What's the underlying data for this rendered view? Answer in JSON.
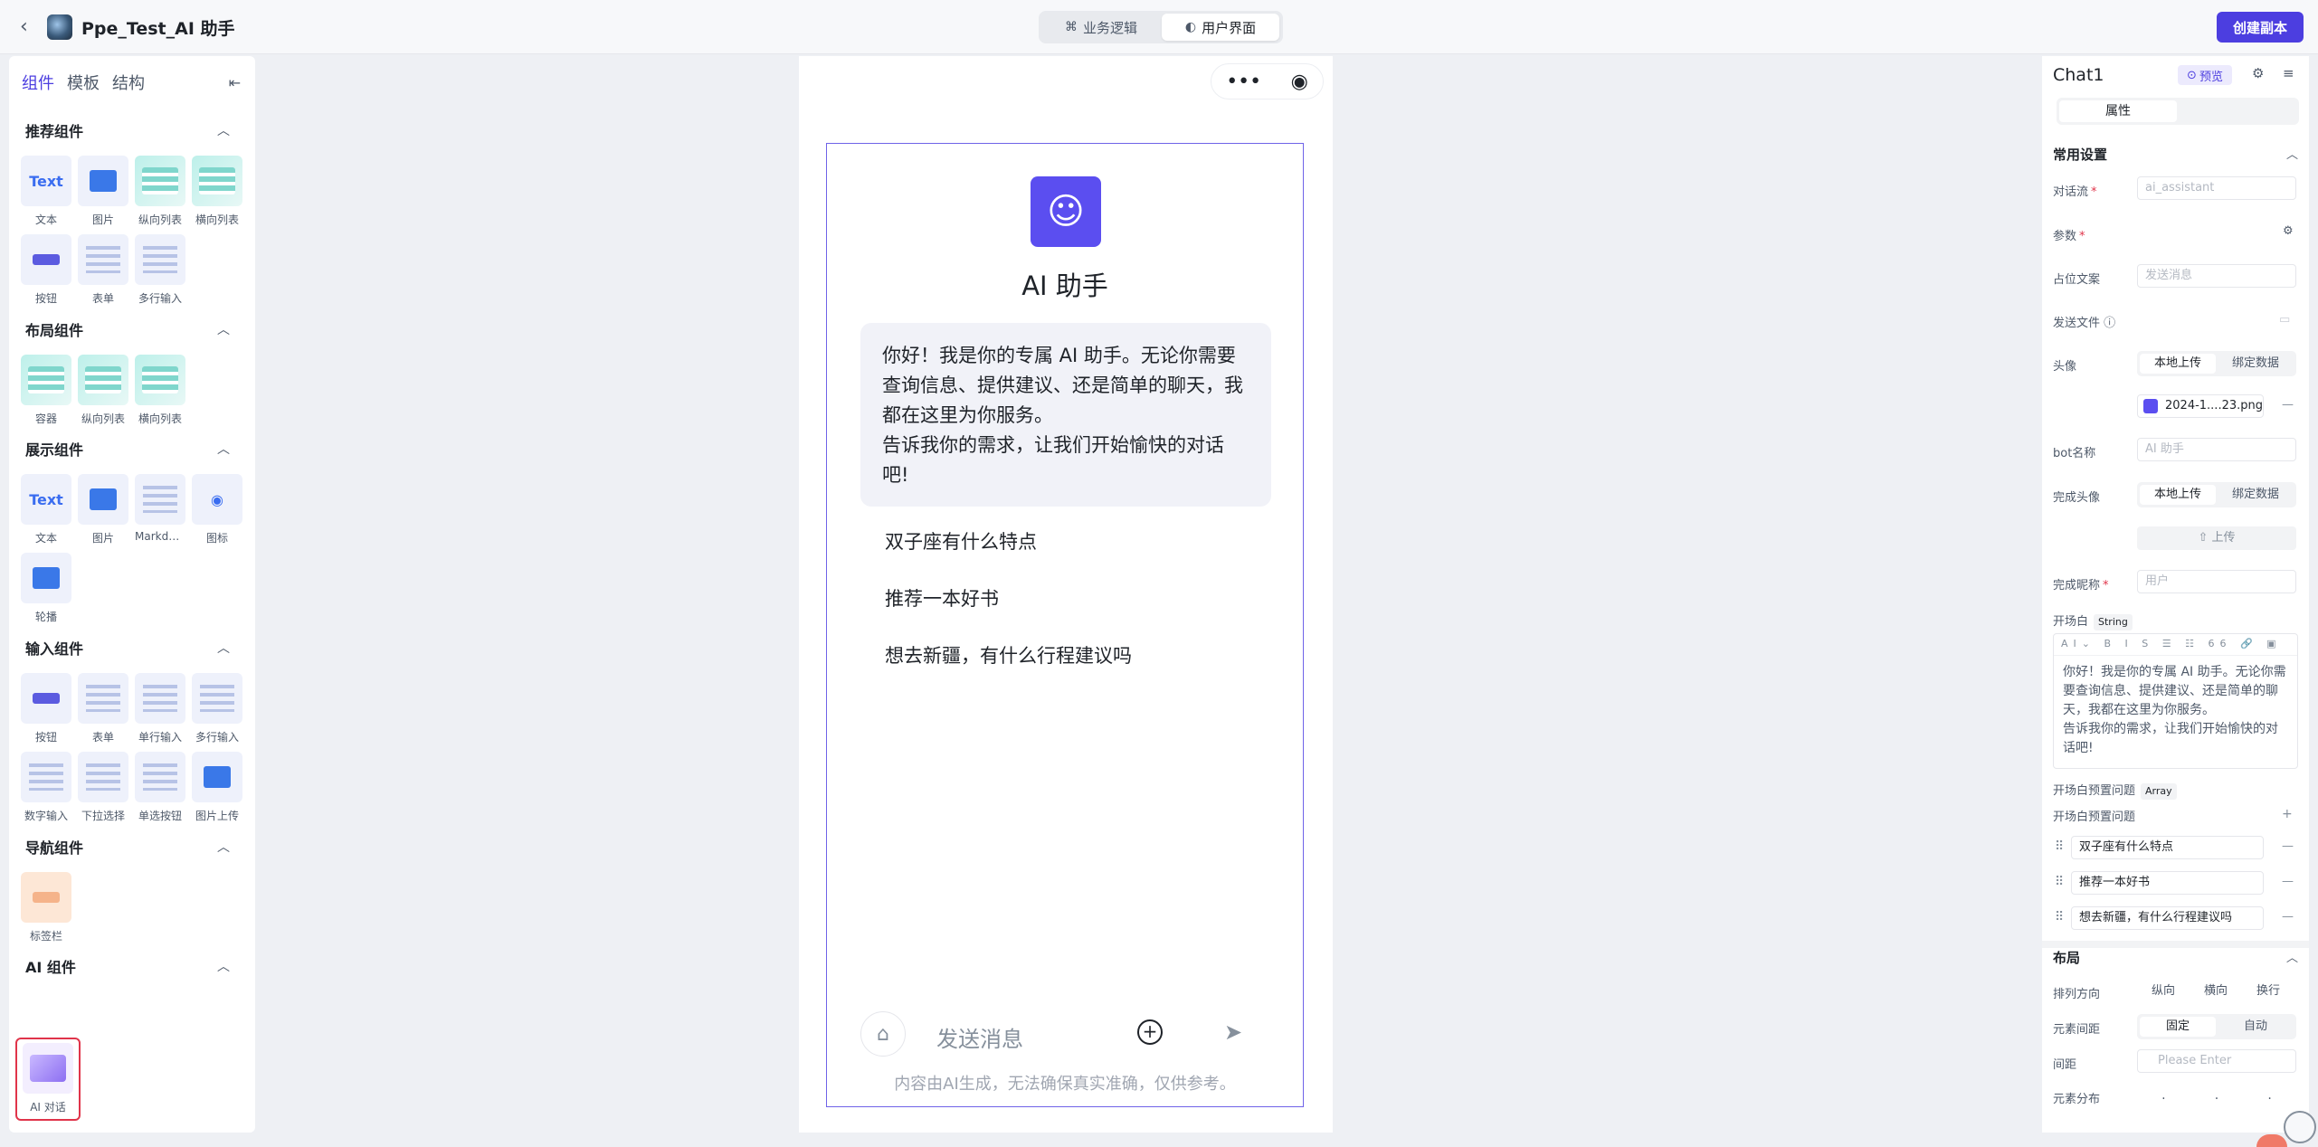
{
  "header": {
    "title": "Ppe_Test_AI 助手",
    "modes": [
      {
        "label": "业务逻辑",
        "icon": "flow-icon"
      },
      {
        "label": "用户界面",
        "icon": "palette-icon"
      }
    ],
    "create_label": "创建副本"
  },
  "left_panel": {
    "tabs": [
      "组件",
      "模板",
      "结构"
    ],
    "sections": [
      {
        "title": "推荐组件",
        "items": [
          "文本",
          "图片",
          "纵向列表",
          "横向列表",
          "按钮",
          "表单",
          "多行输入"
        ]
      },
      {
        "title": "布局组件",
        "items": [
          "容器",
          "纵向列表",
          "横向列表"
        ]
      },
      {
        "title": "展示组件",
        "items": [
          "文本",
          "图片",
          "Markdo…",
          "图标",
          "轮播"
        ]
      },
      {
        "title": "输入组件",
        "items": [
          "按钮",
          "表单",
          "单行输入",
          "多行输入",
          "数字输入",
          "下拉选择",
          "单选按钮",
          "图片上传"
        ]
      },
      {
        "title": "导航组件",
        "items": [
          "标签栏"
        ]
      },
      {
        "title": "AI 组件",
        "items": [
          "AI 对话"
        ]
      }
    ],
    "thumb_text": "Text"
  },
  "canvas": {
    "capsule_more": "•••",
    "capsule_target": "◉",
    "bot_name": "AI 助手",
    "greeting_line1": "你好！我是你的专属 AI 助手。无论你需要查询信息、提供建议、还是简单的聊天，我都在这里为你服务。",
    "greeting_line2": "告诉我你的需求，让我们开始愉快的对话吧!",
    "questions": [
      "双子座有什么特点",
      "推荐一本好书",
      "想去新疆，有什么行程建议吗"
    ],
    "input_placeholder": "发送消息",
    "disclaimer": "内容由AI生成，无法确保真实准确，仅供参考。"
  },
  "right_panel": {
    "title": "Chat1",
    "preview_label": "预览",
    "tab_label": "属性",
    "section_common": "常用设置",
    "labels": {
      "flow": "对话流",
      "params": "参数",
      "placeholder": "占位文案",
      "send_file": "发送文件",
      "avatar": "头像",
      "bot_name": "bot名称",
      "user_avatar": "完成头像",
      "user_nick": "完成昵称",
      "opening": "开场白",
      "preset_q": "开场白预置问题",
      "preset_q2": "开场白预置问题"
    },
    "values": {
      "flow": "ai_assistant",
      "placeholder": "发送消息",
      "file_name": "2024-1....23.png",
      "bot_name": "AI 助手",
      "user_nick": "用户",
      "upload": "上传"
    },
    "tag_string": "String",
    "tag_array": "Array",
    "seg_local": "本地上传",
    "seg_bind": "绑定数据",
    "toolbar": "AI⌄ B I S ☰ ☷ 66 🔗 ▣",
    "opening_line1": "你好！我是你的专属 AI 助手。无论你需要查询信息、提供建议、还是简单的聊天，我都在这里为你服务。",
    "opening_line2": "告诉我你的需求，让我们开始愉快的对话吧!",
    "preset_questions": [
      "双子座有什么特点",
      "推荐一本好书",
      "想去新疆，有什么行程建议吗"
    ],
    "layout_section": "布局",
    "layout_labels": {
      "direction": "排列方向",
      "gap": "元素间距",
      "spacing": "间距",
      "distribution": "元素分布"
    },
    "direction_options": [
      "纵向",
      "横向",
      "换行"
    ],
    "gap_options": [
      "固定",
      "自动"
    ],
    "spacing_placeholder": "Please Enter"
  }
}
